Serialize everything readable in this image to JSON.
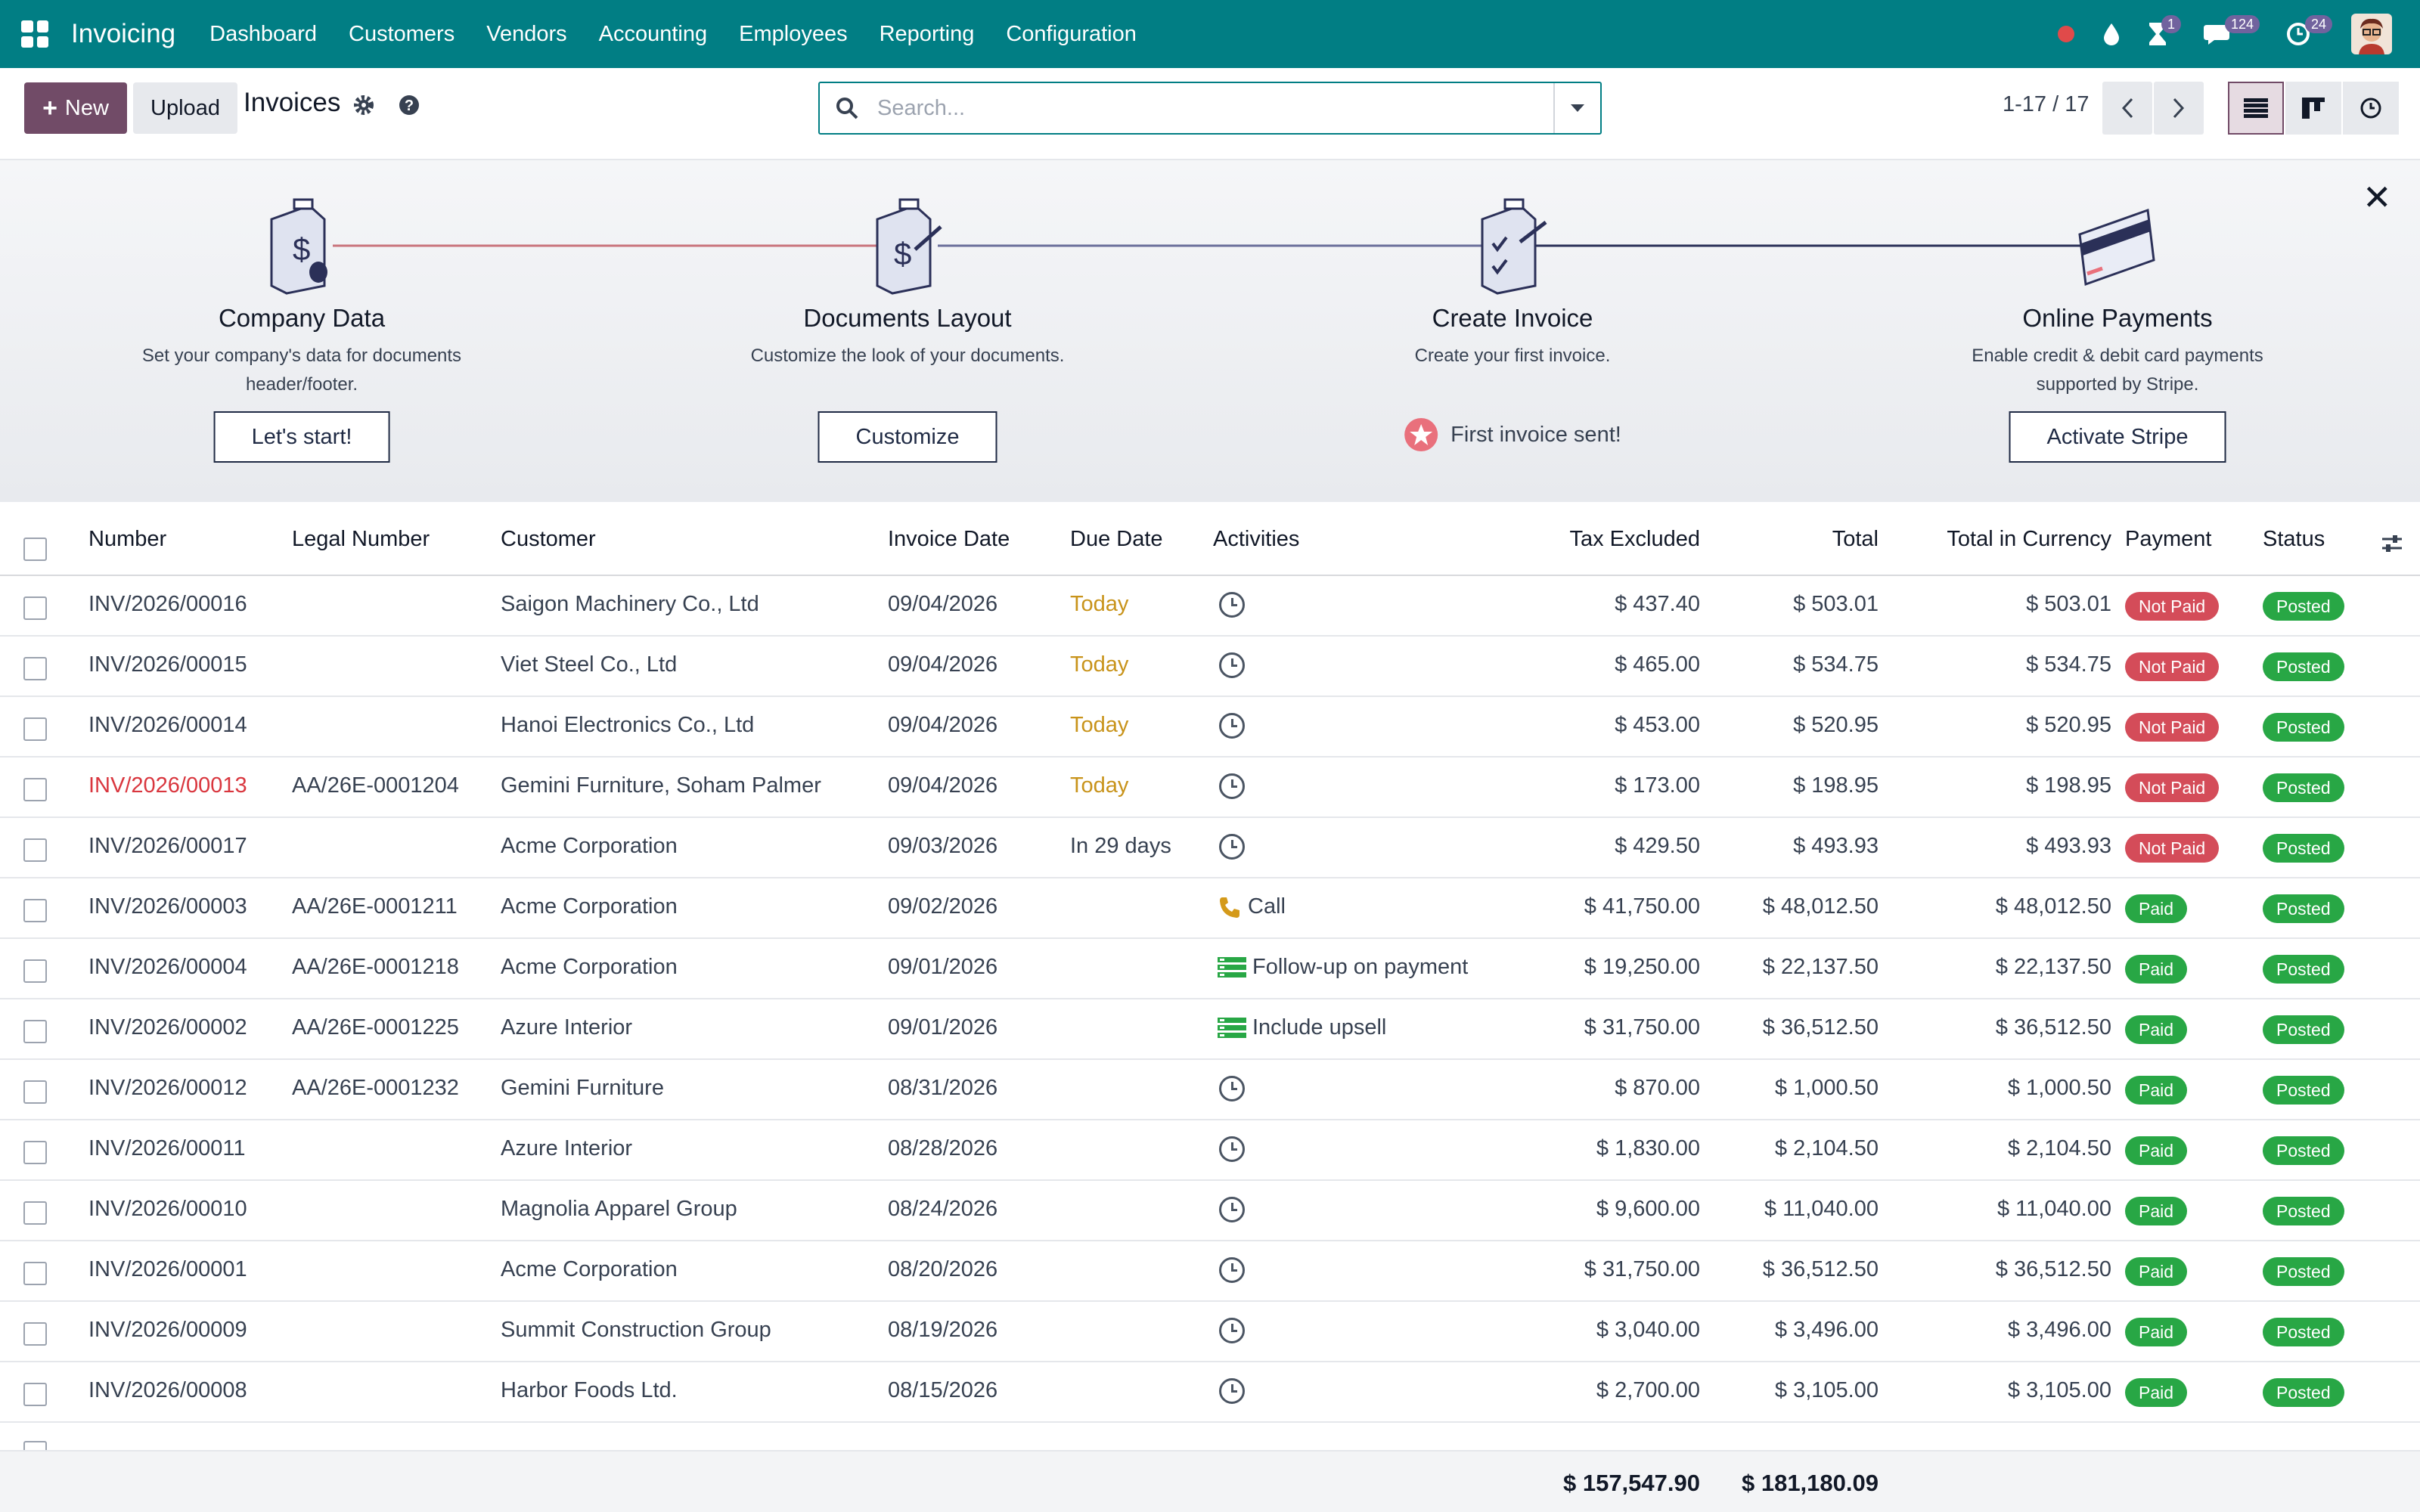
{
  "app": {
    "name": "Invoicing"
  },
  "nav": [
    "Dashboard",
    "Customers",
    "Vendors",
    "Accounting",
    "Employees",
    "Reporting",
    "Configuration"
  ],
  "systray": {
    "activities_count": "1",
    "messages_count": "124",
    "updates_count": "24"
  },
  "toolbar": {
    "new_label": "New",
    "upload_label": "Upload",
    "breadcrumb": "Invoices",
    "search_placeholder": "Search...",
    "pager": "1-17 / 17"
  },
  "onboarding": {
    "steps": [
      {
        "title": "Company Data",
        "description": "Set your company's data for documents header/footer.",
        "button": "Let's start!"
      },
      {
        "title": "Documents Layout",
        "description": "Customize the look of your documents.",
        "button": "Customize"
      },
      {
        "title": "Create Invoice",
        "description": "Create your first invoice.",
        "done": "First invoice sent!"
      },
      {
        "title": "Online Payments",
        "description": "Enable credit & debit card payments supported by Stripe.",
        "button": "Activate Stripe"
      }
    ]
  },
  "columns": [
    "Number",
    "Legal Number",
    "Customer",
    "Invoice Date",
    "Due Date",
    "Activities",
    "Tax Excluded",
    "Total",
    "Total in Currency",
    "Payment",
    "Status"
  ],
  "rows": [
    {
      "number": "INV/2026/00016",
      "legal": "",
      "customer": "Saigon Machinery Co., Ltd",
      "date": "09/04/2026",
      "due": "Today",
      "activity": "",
      "tax_excl": "$ 437.40",
      "total": "$ 503.01",
      "total_cur": "$ 503.01",
      "payment": "Not Paid",
      "status": "Posted"
    },
    {
      "number": "INV/2026/00015",
      "legal": "",
      "customer": "Viet Steel Co., Ltd",
      "date": "09/04/2026",
      "due": "Today",
      "activity": "",
      "tax_excl": "$ 465.00",
      "total": "$ 534.75",
      "total_cur": "$ 534.75",
      "payment": "Not Paid",
      "status": "Posted"
    },
    {
      "number": "INV/2026/00014",
      "legal": "",
      "customer": "Hanoi Electronics Co., Ltd",
      "date": "09/04/2026",
      "due": "Today",
      "activity": "",
      "tax_excl": "$ 453.00",
      "total": "$ 520.95",
      "total_cur": "$ 520.95",
      "payment": "Not Paid",
      "status": "Posted"
    },
    {
      "number": "INV/2026/00013",
      "legal": "AA/26E-0001204",
      "customer": "Gemini Furniture, Soham Palmer",
      "date": "09/04/2026",
      "due": "Today",
      "activity": "",
      "tax_excl": "$ 173.00",
      "total": "$ 198.95",
      "total_cur": "$ 198.95",
      "payment": "Not Paid",
      "status": "Posted"
    },
    {
      "number": "INV/2026/00017",
      "legal": "",
      "customer": "Acme Corporation",
      "date": "09/03/2026",
      "due": "In 29 days",
      "activity": "",
      "tax_excl": "$ 429.50",
      "total": "$ 493.93",
      "total_cur": "$ 493.93",
      "payment": "Not Paid",
      "status": "Posted"
    },
    {
      "number": "INV/2026/00003",
      "legal": "AA/26E-0001211",
      "customer": "Acme Corporation",
      "date": "09/02/2026",
      "due": "",
      "activity": "Call",
      "tax_excl": "$ 41,750.00",
      "total": "$ 48,012.50",
      "total_cur": "$ 48,012.50",
      "payment": "Paid",
      "status": "Posted"
    },
    {
      "number": "INV/2026/00004",
      "legal": "AA/26E-0001218",
      "customer": "Acme Corporation",
      "date": "09/01/2026",
      "due": "",
      "activity": "Follow-up on payment",
      "tax_excl": "$ 19,250.00",
      "total": "$ 22,137.50",
      "total_cur": "$ 22,137.50",
      "payment": "Paid",
      "status": "Posted"
    },
    {
      "number": "INV/2026/00002",
      "legal": "AA/26E-0001225",
      "customer": "Azure Interior",
      "date": "09/01/2026",
      "due": "",
      "activity": "Include upsell",
      "tax_excl": "$ 31,750.00",
      "total": "$ 36,512.50",
      "total_cur": "$ 36,512.50",
      "payment": "Paid",
      "status": "Posted"
    },
    {
      "number": "INV/2026/00012",
      "legal": "AA/26E-0001232",
      "customer": "Gemini Furniture",
      "date": "08/31/2026",
      "due": "",
      "activity": "",
      "tax_excl": "$ 870.00",
      "total": "$ 1,000.50",
      "total_cur": "$ 1,000.50",
      "payment": "Paid",
      "status": "Posted"
    },
    {
      "number": "INV/2026/00011",
      "legal": "",
      "customer": "Azure Interior",
      "date": "08/28/2026",
      "due": "",
      "activity": "",
      "tax_excl": "$ 1,830.00",
      "total": "$ 2,104.50",
      "total_cur": "$ 2,104.50",
      "payment": "Paid",
      "status": "Posted"
    },
    {
      "number": "INV/2026/00010",
      "legal": "",
      "customer": "Magnolia Apparel Group",
      "date": "08/24/2026",
      "due": "",
      "activity": "",
      "tax_excl": "$ 9,600.00",
      "total": "$ 11,040.00",
      "total_cur": "$ 11,040.00",
      "payment": "Paid",
      "status": "Posted"
    },
    {
      "number": "INV/2026/00001",
      "legal": "",
      "customer": "Acme Corporation",
      "date": "08/20/2026",
      "due": "",
      "activity": "",
      "tax_excl": "$ 31,750.00",
      "total": "$ 36,512.50",
      "total_cur": "$ 36,512.50",
      "payment": "Paid",
      "status": "Posted"
    },
    {
      "number": "INV/2026/00009",
      "legal": "",
      "customer": "Summit Construction Group",
      "date": "08/19/2026",
      "due": "",
      "activity": "",
      "tax_excl": "$ 3,040.00",
      "total": "$ 3,496.00",
      "total_cur": "$ 3,496.00",
      "payment": "Paid",
      "status": "Posted"
    },
    {
      "number": "INV/2026/00008",
      "legal": "",
      "customer": "Harbor Foods Ltd.",
      "date": "08/15/2026",
      "due": "",
      "activity": "",
      "tax_excl": "$ 2,700.00",
      "total": "$ 3,105.00",
      "total_cur": "$ 3,105.00",
      "payment": "Paid",
      "status": "Posted"
    }
  ],
  "totals": {
    "tax_excl": "$ 157,547.90",
    "total": "$ 181,180.09"
  },
  "colors": {
    "brand": "#017e84",
    "primary_button": "#714b67",
    "not_paid": "#d44c59",
    "paid": "#28a745",
    "today": "#c8931a",
    "overdue_number": "#d9363e"
  }
}
